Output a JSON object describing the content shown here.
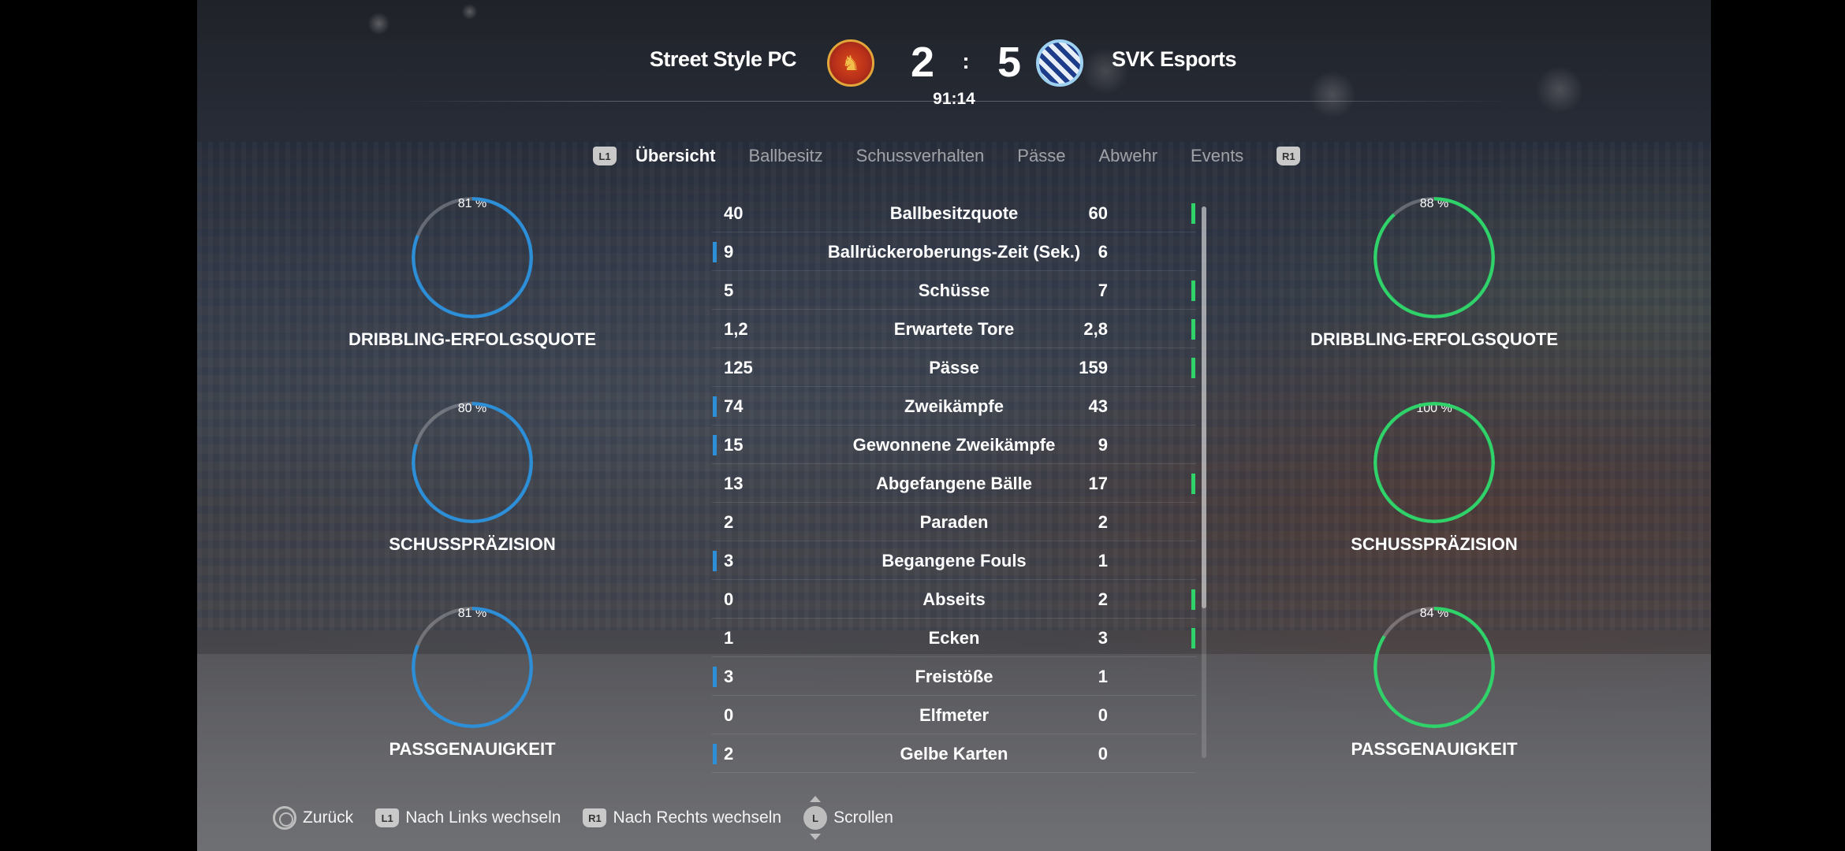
{
  "match": {
    "home_team": "Street Style PC",
    "away_team": "SVK Esports",
    "home_score": "2",
    "separator": ":",
    "away_score": "5",
    "clock": "91:14"
  },
  "tabs": {
    "left_shoulder": "L1",
    "right_shoulder": "R1",
    "items": [
      "Übersicht",
      "Ballbesitz",
      "Schussverhalten",
      "Pässe",
      "Abwehr",
      "Events"
    ],
    "active": "Übersicht"
  },
  "home_rings": [
    {
      "value": "81 %",
      "fraction": 0.81,
      "label": "DRIBBLING-ERFOLGSQUOTE"
    },
    {
      "value": "80 %",
      "fraction": 0.8,
      "label": "SCHUSSPRÄZISION"
    },
    {
      "value": "81 %",
      "fraction": 0.81,
      "label": "PASSGENAUIGKEIT"
    }
  ],
  "away_rings": [
    {
      "value": "88 %",
      "fraction": 0.88,
      "label": "DRIBBLING-ERFOLGSQUOTE"
    },
    {
      "value": "100 %",
      "fraction": 1.0,
      "label": "SCHUSSPRÄZISION"
    },
    {
      "value": "84 %",
      "fraction": 0.84,
      "label": "PASSGENAUIGKEIT"
    }
  ],
  "stats": [
    {
      "label": "Ballbesitzquote",
      "home": "40",
      "away": "60",
      "lead": "away"
    },
    {
      "label": "Ballrückeroberungs-Zeit (Sek.)",
      "home": "9",
      "away": "6",
      "lead": "home"
    },
    {
      "label": "Schüsse",
      "home": "5",
      "away": "7",
      "lead": "away"
    },
    {
      "label": "Erwartete Tore",
      "home": "1,2",
      "away": "2,8",
      "lead": "away"
    },
    {
      "label": "Pässe",
      "home": "125",
      "away": "159",
      "lead": "away"
    },
    {
      "label": "Zweikämpfe",
      "home": "74",
      "away": "43",
      "lead": "home"
    },
    {
      "label": "Gewonnene Zweikämpfe",
      "home": "15",
      "away": "9",
      "lead": "home"
    },
    {
      "label": "Abgefangene Bälle",
      "home": "13",
      "away": "17",
      "lead": "away"
    },
    {
      "label": "Paraden",
      "home": "2",
      "away": "2",
      "lead": "none"
    },
    {
      "label": "Begangene Fouls",
      "home": "3",
      "away": "1",
      "lead": "home"
    },
    {
      "label": "Abseits",
      "home": "0",
      "away": "2",
      "lead": "away"
    },
    {
      "label": "Ecken",
      "home": "1",
      "away": "3",
      "lead": "away"
    },
    {
      "label": "Freistöße",
      "home": "3",
      "away": "1",
      "lead": "home"
    },
    {
      "label": "Elfmeter",
      "home": "0",
      "away": "0",
      "lead": "none"
    },
    {
      "label": "Gelbe Karten",
      "home": "2",
      "away": "0",
      "lead": "home"
    }
  ],
  "footer": {
    "back_label": "Zurück",
    "left_label": "Nach Links wechseln",
    "left_button": "L1",
    "right_label": "Nach Rechts wechseln",
    "right_button": "R1",
    "scroll_label": "Scrollen",
    "scroll_button": "L"
  },
  "colors": {
    "home_accent": "#2d8fd8",
    "away_accent": "#2fd36a"
  },
  "icons": {
    "home_crest": "lion-crest-icon",
    "away_crest": "checkered-crest-icon",
    "back_button": "circle-button-icon",
    "scroll_stick": "left-stick-icon"
  }
}
